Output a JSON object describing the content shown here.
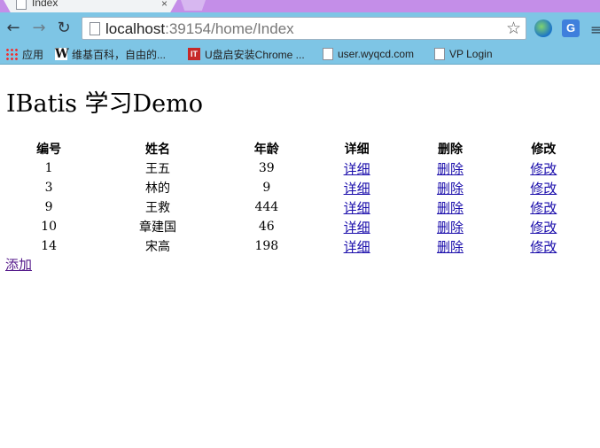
{
  "browser": {
    "tab_title": "Index",
    "tab_close": "×",
    "url_host": "localhost",
    "url_path": ":39154/home/Index",
    "bookmarks": [
      {
        "label": "应用",
        "icon": "apps-grid-icon"
      },
      {
        "label": "维基百科，自由的...",
        "icon": "wikipedia-icon"
      },
      {
        "label": "U盘启安装Chrome ...",
        "icon": "it-icon"
      },
      {
        "label": "user.wyqcd.com",
        "icon": "page-icon"
      },
      {
        "label": "VP Login",
        "icon": "page-icon"
      }
    ]
  },
  "page": {
    "title": "IBatis 学习Demo",
    "table": {
      "headers": [
        "编号",
        "姓名",
        "年龄",
        "详细",
        "删除",
        "修改"
      ],
      "rows": [
        {
          "id": "1",
          "name": "王五",
          "age": "39",
          "detail": "详细",
          "delete": "删除",
          "edit": "修改"
        },
        {
          "id": "3",
          "name": "林的",
          "age": "9",
          "detail": "详细",
          "delete": "删除",
          "edit": "修改"
        },
        {
          "id": "9",
          "name": "王救",
          "age": "444",
          "detail": "详细",
          "delete": "删除",
          "edit": "修改"
        },
        {
          "id": "10",
          "name": "章建国",
          "age": "46",
          "detail": "详细",
          "delete": "删除",
          "edit": "修改"
        },
        {
          "id": "14",
          "name": "宋高",
          "age": "198",
          "detail": "详细",
          "delete": "删除",
          "edit": "修改"
        }
      ]
    },
    "add_link": "添加"
  }
}
